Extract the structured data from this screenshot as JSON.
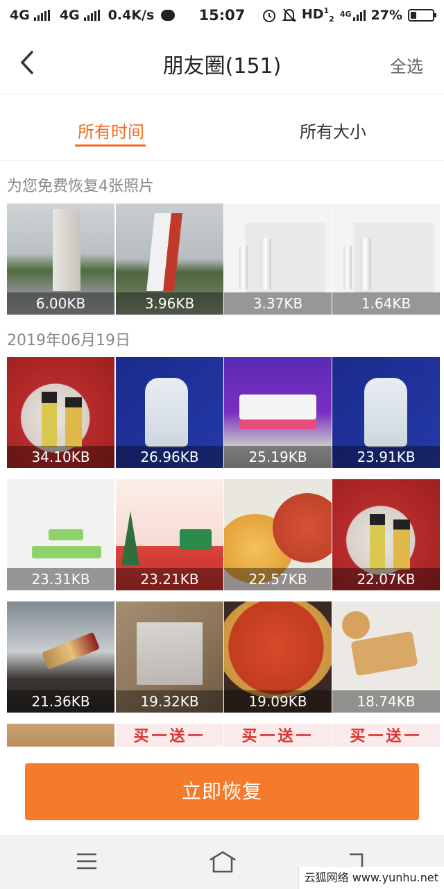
{
  "status_bar": {
    "net1": "4G",
    "net2": "4G",
    "speed": "0.4K/s",
    "time": "15:07",
    "hd": "HD",
    "hd_sup": "1",
    "hd_sub": "2",
    "net3": "4G",
    "battery": "27%",
    "battery_level": 0.27
  },
  "nav": {
    "title": "朋友圈(151)",
    "select_all": "全选"
  },
  "tabs": [
    {
      "label": "所有时间",
      "active": true
    },
    {
      "label": "所有大小",
      "active": false
    }
  ],
  "sections": [
    {
      "title": "为您免费恢复4张照片",
      "photos": [
        "6.00KB",
        "3.96KB",
        "3.37KB",
        "1.64KB"
      ]
    },
    {
      "title": "2019年06月19日",
      "photos": [
        "34.10KB",
        "26.96KB",
        "25.19KB",
        "23.91KB",
        "23.31KB",
        "23.21KB",
        "22.57KB",
        "22.07KB",
        "21.36KB",
        "19.32KB",
        "19.09KB",
        "18.74KB"
      ]
    }
  ],
  "peek_text": "买一送一",
  "restore_button": "立即恢复",
  "watermark": "云狐网络 www.yunhu.net"
}
